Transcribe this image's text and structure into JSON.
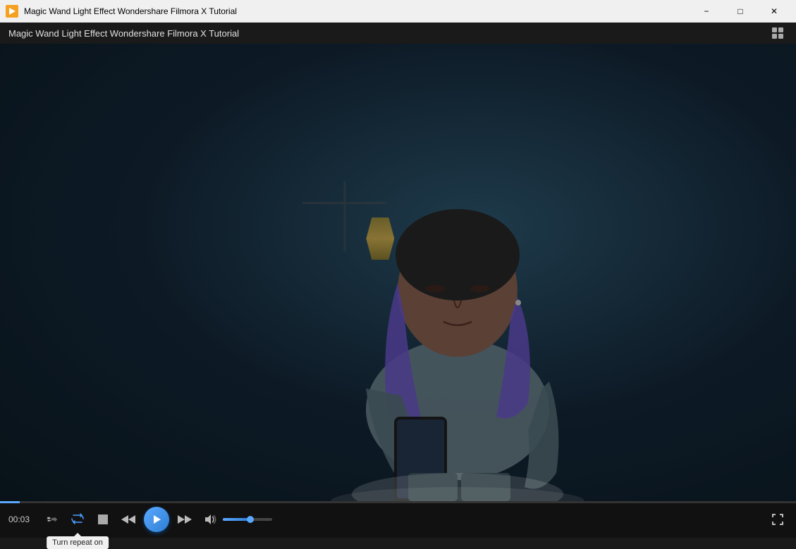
{
  "titleBar": {
    "appIconColor": "#f5a020",
    "windowTitle": "Magic Wand Light Effect  Wondershare Filmora X Tutorial",
    "minBtn": "−",
    "maxBtn": "□",
    "closeBtn": "✕"
  },
  "menuBar": {
    "title": "Magic Wand Light Effect  Wondershare Filmora X Tutorial",
    "gridIcon": "⊞"
  },
  "controls": {
    "time": "00:03",
    "tooltip": "Turn repeat on",
    "playIcon": "▶",
    "stopIcon": "",
    "volumePercent": 55,
    "progressPercent": 2.5
  }
}
